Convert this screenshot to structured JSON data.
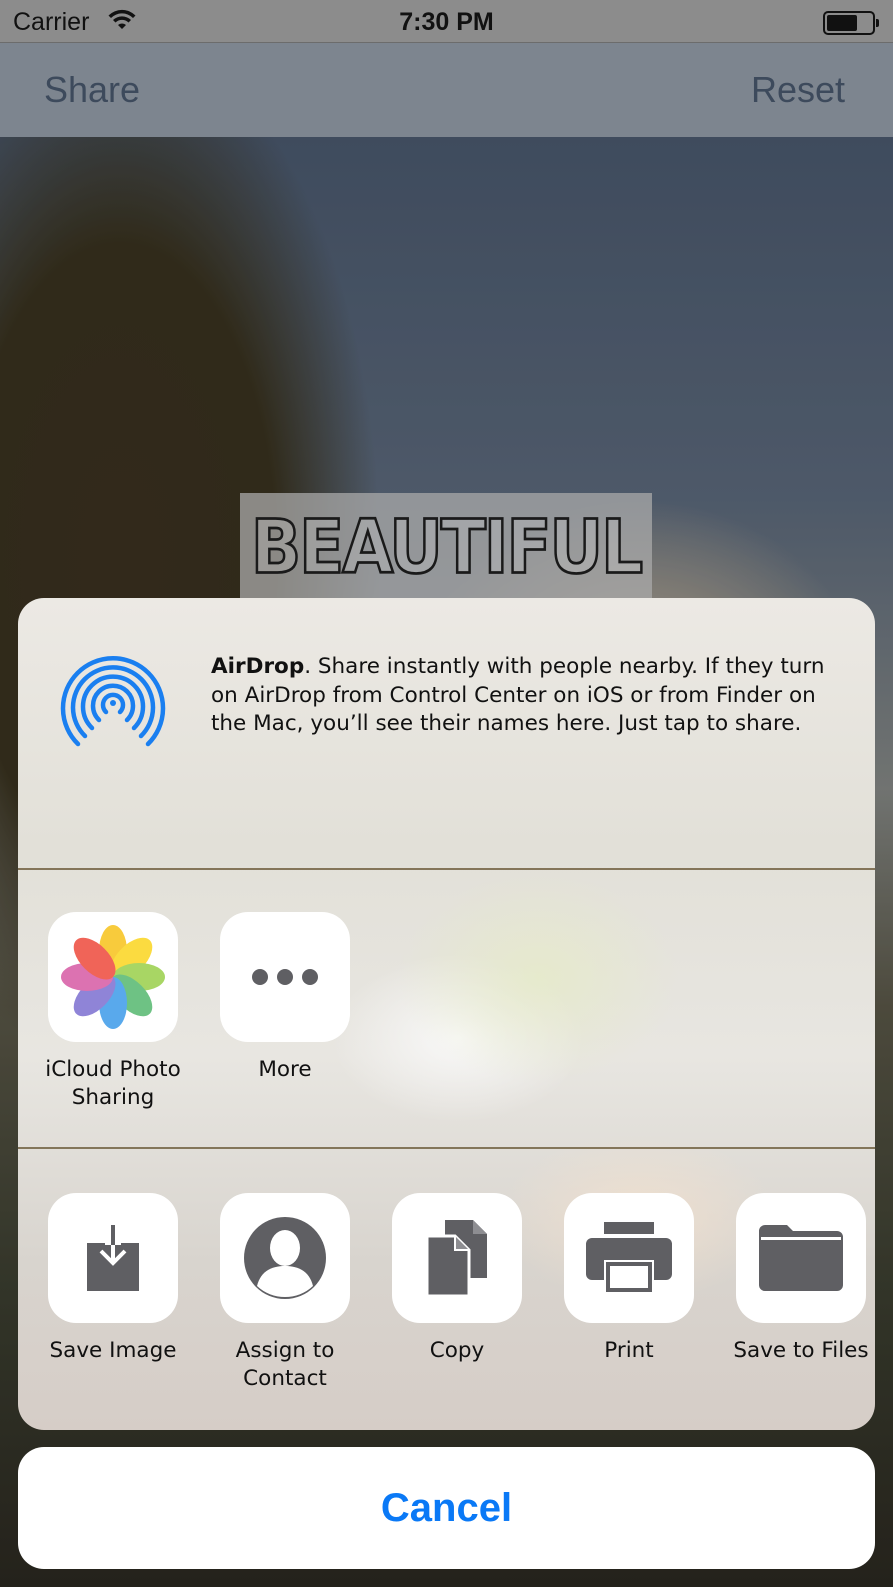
{
  "status_bar": {
    "carrier": "Carrier",
    "time": "7:30 PM"
  },
  "nav": {
    "left": "Share",
    "right": "Reset"
  },
  "caption": "BEAUTIFUL",
  "airdrop": {
    "title": "AirDrop",
    "text": ". Share instantly with people nearby. If they turn on AirDrop from Control Center on iOS or from Finder on the Mac, you’ll see their names here. Just tap to share."
  },
  "apps": [
    {
      "label": "iCloud Photo Sharing",
      "icon": "photos-icon"
    },
    {
      "label": "More",
      "icon": "more-icon"
    }
  ],
  "actions": [
    {
      "label": "Save Image",
      "icon": "save-image-icon"
    },
    {
      "label": "Assign to Contact",
      "icon": "contact-icon"
    },
    {
      "label": "Copy",
      "icon": "copy-icon"
    },
    {
      "label": "Print",
      "icon": "print-icon"
    },
    {
      "label": "Save to Files",
      "icon": "folder-icon"
    }
  ],
  "cancel_label": "Cancel",
  "colors": {
    "accent": "#0a79f6",
    "airdrop": "#1a7ff0",
    "glyph": "#5f5f63"
  }
}
